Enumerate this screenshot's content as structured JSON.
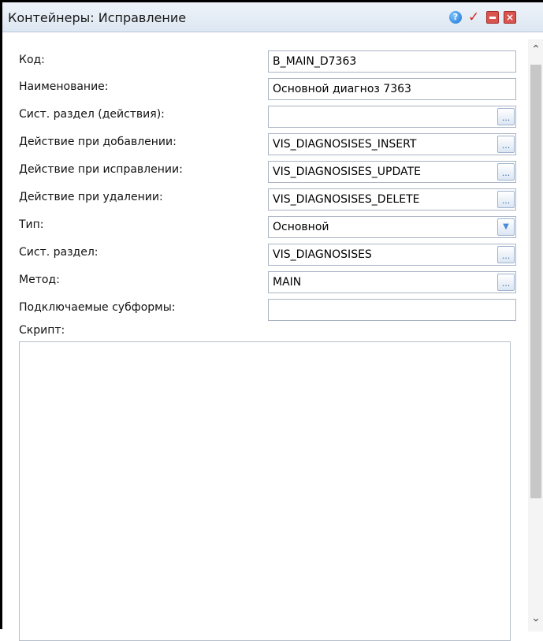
{
  "window": {
    "title": "Контейнеры: Исправление"
  },
  "form": {
    "fields": [
      {
        "label": "Код:",
        "value": "B_MAIN_D7363"
      },
      {
        "label": "Наименование:",
        "value": "Основной диагноз 7363"
      },
      {
        "label": "Сист. раздел (действия):",
        "value": ""
      },
      {
        "label": "Действие при добавлении:",
        "value": "VIS_DIAGNOSISES_INSERT"
      },
      {
        "label": "Действие при исправлении:",
        "value": "VIS_DIAGNOSISES_UPDATE"
      },
      {
        "label": "Действие при удалении:",
        "value": "VIS_DIAGNOSISES_DELETE"
      },
      {
        "label": "Тип:",
        "value": "Основной"
      },
      {
        "label": "Сист. раздел:",
        "value": "VIS_DIAGNOSISES"
      },
      {
        "label": "Метод:",
        "value": "MAIN"
      },
      {
        "label": "Подключаемые субформы:",
        "value": ""
      }
    ],
    "script_label": "Скрипт:",
    "script_value": ""
  },
  "icons": {
    "help": "help-icon",
    "apply": "check-icon",
    "minimize": "minimize-icon",
    "close": "close-icon",
    "lookup_glyph": "...",
    "combo_glyph": "▼"
  },
  "colors": {
    "titlebar": "#dde7f2",
    "accent_red": "#d9534f",
    "field_border": "#a9b4c2"
  }
}
